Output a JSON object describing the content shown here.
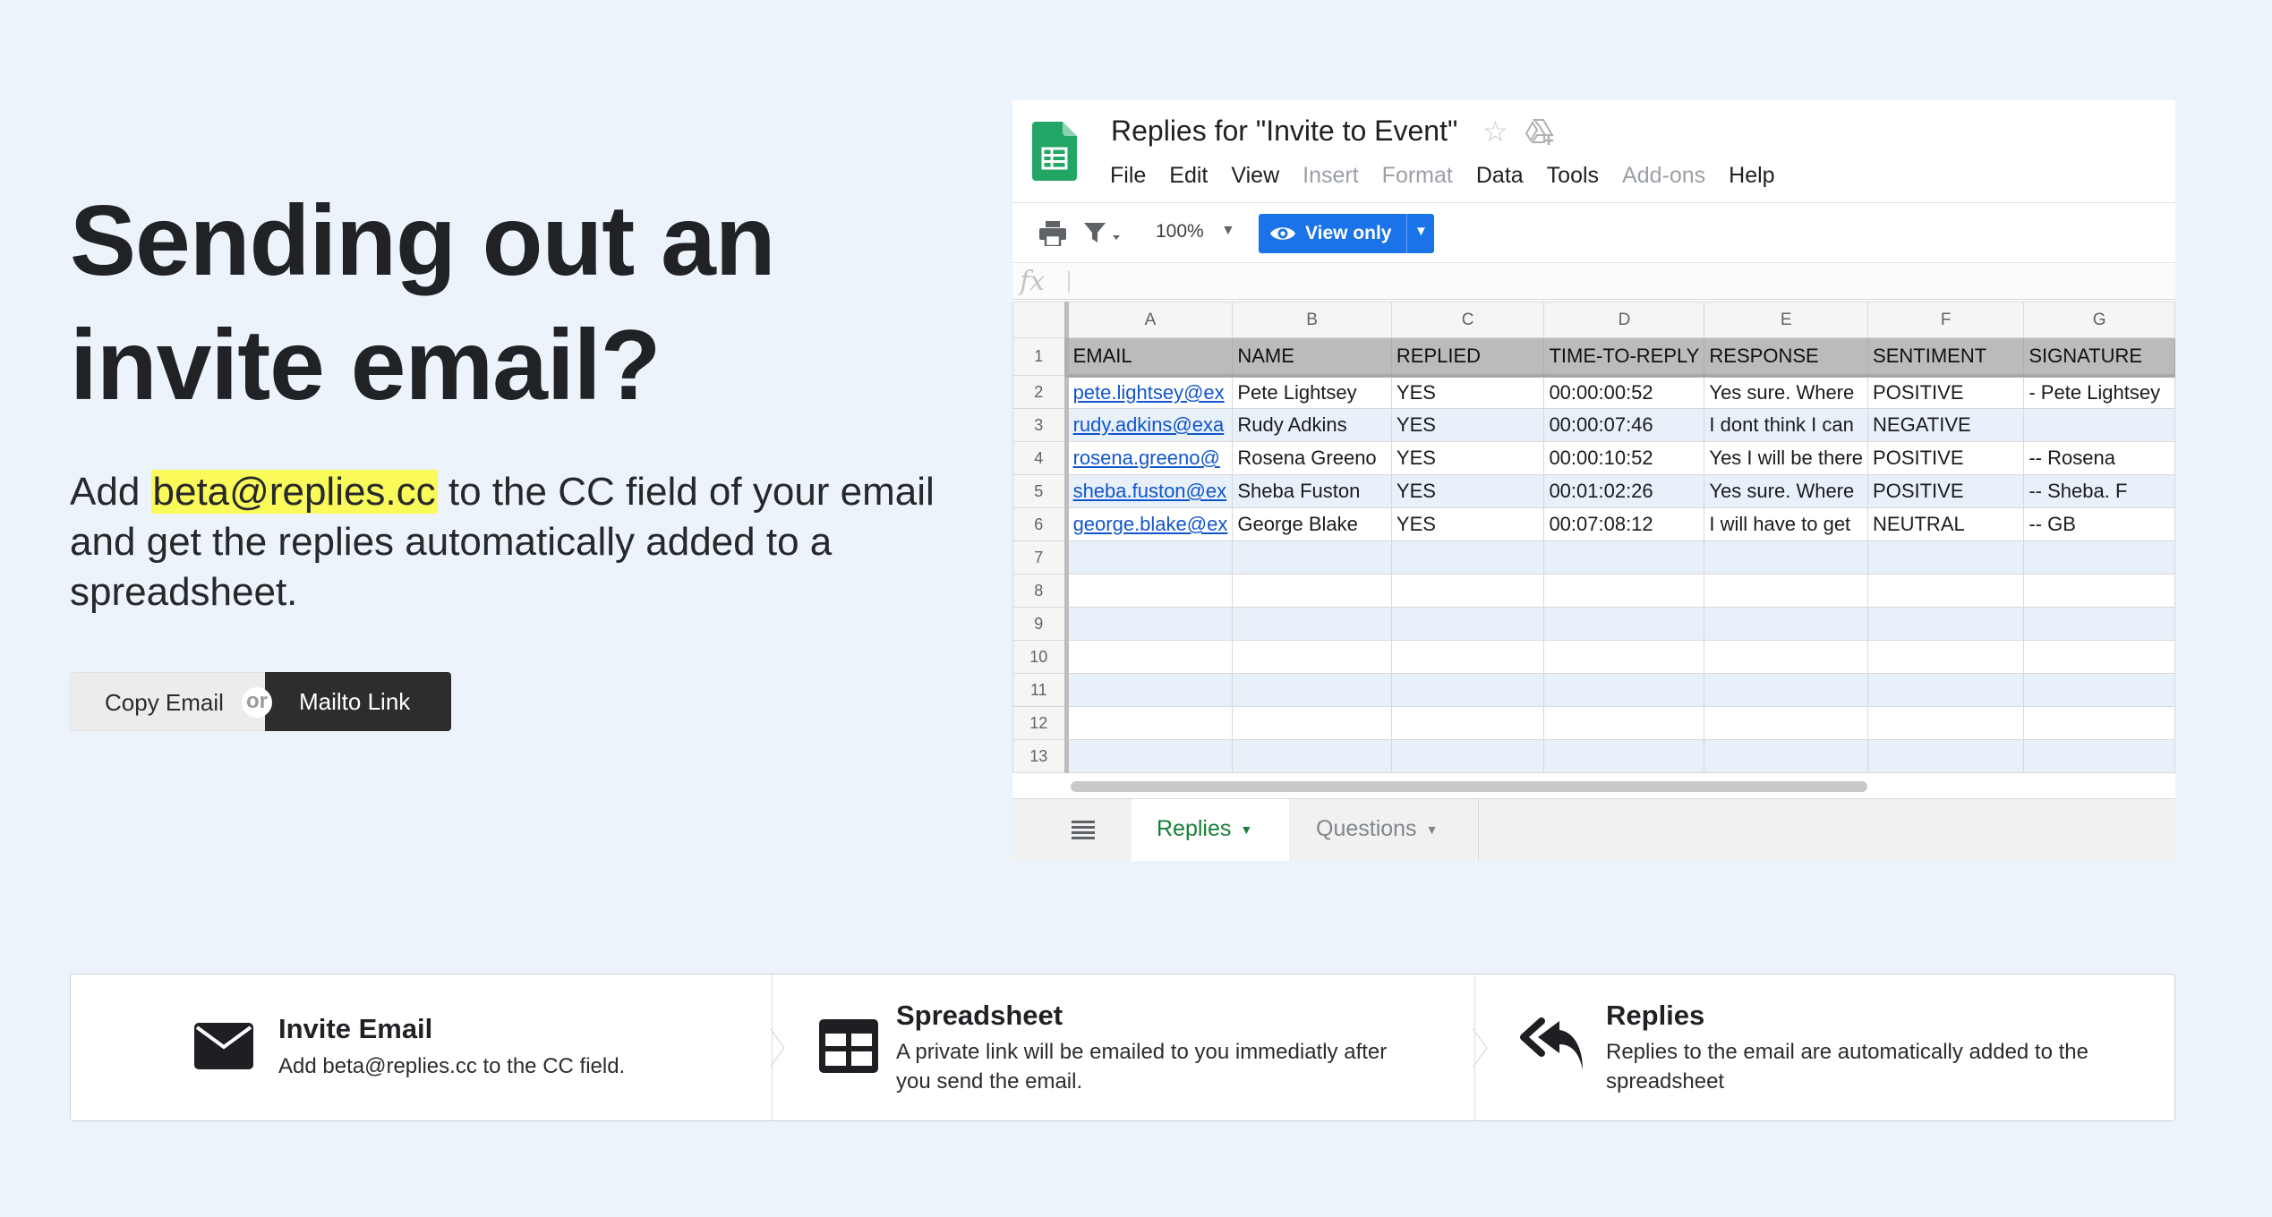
{
  "hero": {
    "title_line1": "Sending out an",
    "title_line2": "invite email?",
    "desc_before": "Add ",
    "desc_highlight": "beta@replies.cc",
    "desc_after": " to the CC field of your email and get the replies automatically added to a spreadsheet.",
    "copy_button": "Copy Email",
    "or_label": "or",
    "mailto_button": "Mailto Link"
  },
  "sheet": {
    "doc_title": "Replies for \"Invite to Event\"",
    "menu": [
      {
        "label": "File",
        "disabled": false
      },
      {
        "label": "Edit",
        "disabled": false
      },
      {
        "label": "View",
        "disabled": false
      },
      {
        "label": "Insert",
        "disabled": true
      },
      {
        "label": "Format",
        "disabled": true
      },
      {
        "label": "Data",
        "disabled": false
      },
      {
        "label": "Tools",
        "disabled": false
      },
      {
        "label": "Add-ons",
        "disabled": true
      },
      {
        "label": "Help",
        "disabled": false
      }
    ],
    "zoom": "100%",
    "view_only_label": "View only",
    "fx_label": "fx",
    "column_letters": [
      "A",
      "B",
      "C",
      "D",
      "E",
      "F",
      "G"
    ],
    "header_row": [
      "EMAIL",
      "NAME",
      "REPLIED",
      "TIME-TO-REPLY",
      "RESPONSE",
      "SENTIMENT",
      "SIGNATURE"
    ],
    "rows": [
      [
        "pete.lightsey@ex",
        "Pete Lightsey",
        "YES",
        "00:00:00:52",
        "Yes sure. Where",
        "POSITIVE",
        "- Pete Lightsey"
      ],
      [
        "rudy.adkins@exa",
        "Rudy Adkins",
        "YES",
        "00:00:07:46",
        "I dont think I can",
        "NEGATIVE",
        ""
      ],
      [
        "rosena.greeno@",
        "Rosena Greeno",
        "YES",
        "00:00:10:52",
        "Yes I will be there",
        "POSITIVE",
        "-- Rosena"
      ],
      [
        "sheba.fuston@ex",
        "Sheba Fuston",
        "YES",
        "00:01:02:26",
        "Yes sure. Where",
        "POSITIVE",
        "-- Sheba. F"
      ],
      [
        "george.blake@ex",
        "George Blake",
        "YES",
        "00:07:08:12",
        "I will have to get",
        "NEUTRAL",
        "-- GB"
      ]
    ],
    "row_numbers": [
      "1",
      "2",
      "3",
      "4",
      "5",
      "6",
      "7",
      "8",
      "9",
      "10",
      "11",
      "12",
      "13"
    ],
    "tabs": {
      "replies": "Replies",
      "questions": "Questions"
    }
  },
  "features": [
    {
      "title": "Invite Email",
      "desc": "Add beta@replies.cc to the CC field.",
      "icon": "envelope-icon"
    },
    {
      "title": "Spreadsheet",
      "desc": "A private link will be emailed to you immediatly after you send the email.",
      "icon": "table-icon"
    },
    {
      "title": "Replies",
      "desc": "Replies to the email are automatically added to the spreadsheet",
      "icon": "reply-all-icon"
    }
  ],
  "colors": {
    "background": "#ecf3fb",
    "highlight": "#fafa5a",
    "link": "#1155cc",
    "sheets_green": "#188038",
    "view_only_blue": "#1a73e8"
  }
}
